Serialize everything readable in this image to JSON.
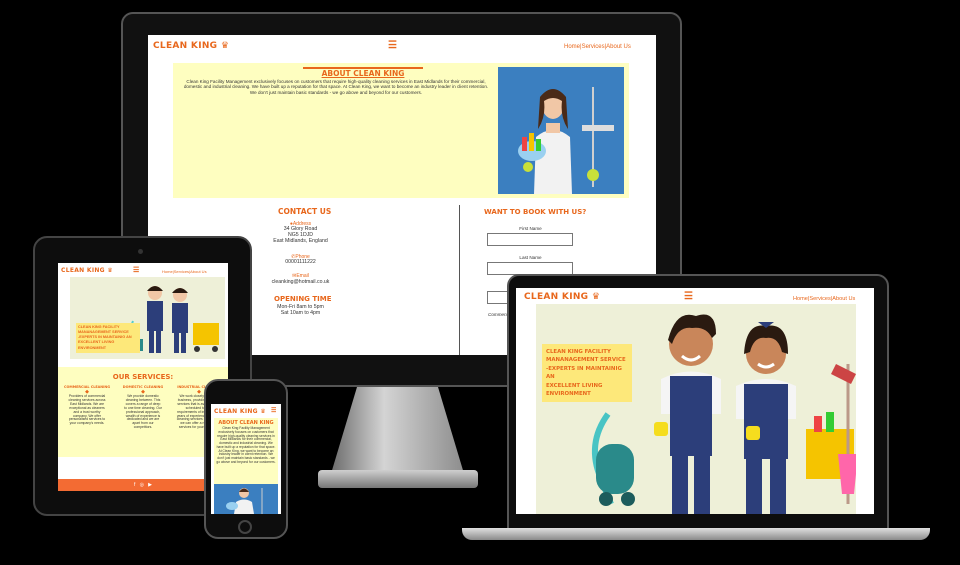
{
  "brand": "CLEAN KING",
  "nav": {
    "home": "Home",
    "sep": "|",
    "services": "Services",
    "about": "About Us"
  },
  "burger": "☰",
  "crown": "♛",
  "about": {
    "title": "ABOUT CLEAN KING",
    "body": "Clean King Facility Management exclusively focuses on customers that require high-quality cleaning services in East Midlands for their commercial, domestic and industrial cleaning. We have built up a reputation for that space. At Clean King, we want to become an industry leader in client retention. We don't just maintain basic standards - we go above and beyond for our customers.",
    "image_alt": "woman with cleaning supplies"
  },
  "contact": {
    "title": "CONTACT US",
    "address_label": "Address",
    "address": [
      "34 Glory Road",
      "NG5 1DJD",
      "East Midlands, England"
    ],
    "phone_label": "Phone",
    "phone": "00001111222",
    "email_label": "Email",
    "email": "cleanking@hotmail.co.uk",
    "hours_title": "OPENING TIME",
    "hours": [
      "Mon-Fri 8am to 5pm",
      "Sat 10am to 4pm"
    ]
  },
  "booking": {
    "title": "WANT TO BOOK WITH US?",
    "first_name": "First Name",
    "last_name": "Last Name",
    "comment": "Comment"
  },
  "hero": {
    "line1": "CLEAN KING FACILITY",
    "line2": "MANANAGEMENT SERVICE",
    "line3": "-EXPERTS IN MAINTAINIG AN",
    "line4": "EXCELLENT LIVING",
    "line5": "ENVIRONMENT"
  },
  "services": {
    "title": "OUR SERVICES:",
    "items": [
      {
        "title": "COMMERCIAL CLEANING",
        "text": "Providers of commercial cleaning services across East Midlands. We are exceptional as cleaners and a trust worthy company. We offer personalised services to your company's needs."
      },
      {
        "title": "DOMESTIC CLEANING",
        "text": "We provide domestic cleaning between. This covers a range of deep to one time cleaning. Our professional approach, wealth of experience is dedicated and we are apart from our competitors."
      },
      {
        "title": "INDUSTRIAL CLEANING",
        "text": "We work closely with your business, providing cleaning services that is available and scheduled to your requirements of industry. Our years of experience providing cleaning services suppressed we can offer a number of services for your business."
      }
    ]
  },
  "phone_about_body": "Clean King Facility Management exclusively focuses on customers that require high-quality cleaning services in East Midlands for their commercial, domestic and industrial cleaning. We have built up a reputation for that space. At Clean King, we want to become an industry leader in client retention. We don't just maintain basic standards - we go above and beyond for our customers.",
  "social": [
    "f",
    "◎",
    "▶"
  ],
  "colors": {
    "accent": "#e8671c",
    "cream": "#fefec0",
    "hero_bg": "#eef0d8",
    "footer": "#f36b33",
    "photo_bg": "#3b7fc0"
  }
}
